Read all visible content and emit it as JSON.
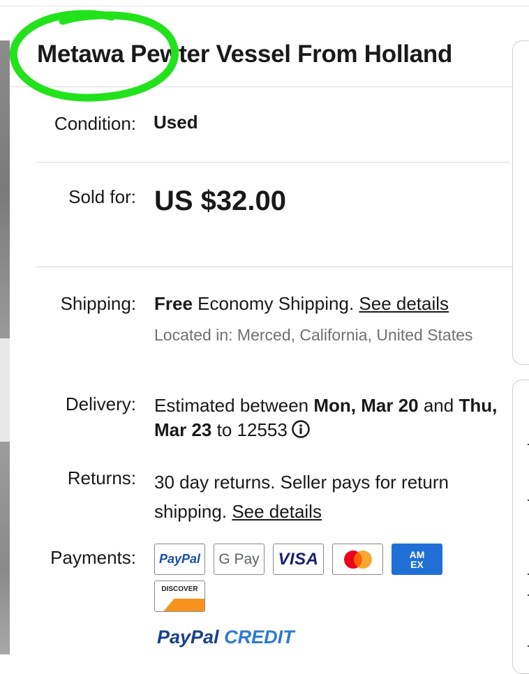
{
  "item": {
    "title": "Metawa Pewter Vessel From Holland"
  },
  "condition": {
    "label": "Condition:",
    "value": "Used"
  },
  "sold": {
    "label": "Sold for:",
    "price": "US $32.00"
  },
  "shipping": {
    "label": "Shipping:",
    "free": "Free",
    "method": " Economy Shipping. ",
    "details_link": "See details",
    "located": "Located in: Merced, California, United States"
  },
  "delivery": {
    "label": "Delivery:",
    "prefix": "Estimated between ",
    "start": "Mon, Mar 20",
    "and": " and ",
    "end": "Thu, Mar 23",
    "to": " to 12553",
    "info_icon": "info-icon"
  },
  "returns": {
    "label": "Returns:",
    "text": "30 day returns. Seller pays for return shipping. ",
    "details_link": "See details"
  },
  "payments": {
    "label": "Payments:",
    "methods": [
      "PayPal",
      "G Pay",
      "VISA",
      "Mastercard",
      "AM EX",
      "DISCOVER"
    ],
    "paypal_credit": [
      "PayPal",
      "CREDIT"
    ]
  },
  "annotation": {
    "shape": "green-hand-drawn-circle",
    "color": "#22e31b"
  },
  "colors": {
    "text": "#191919",
    "muted": "#707070",
    "paypal_blue": "#1a4fa3",
    "amex_blue": "#1f6fd6",
    "mastercard_red": "#eb001b",
    "mastercard_orange": "#f79e1b",
    "discover_orange": "#f7931d"
  }
}
